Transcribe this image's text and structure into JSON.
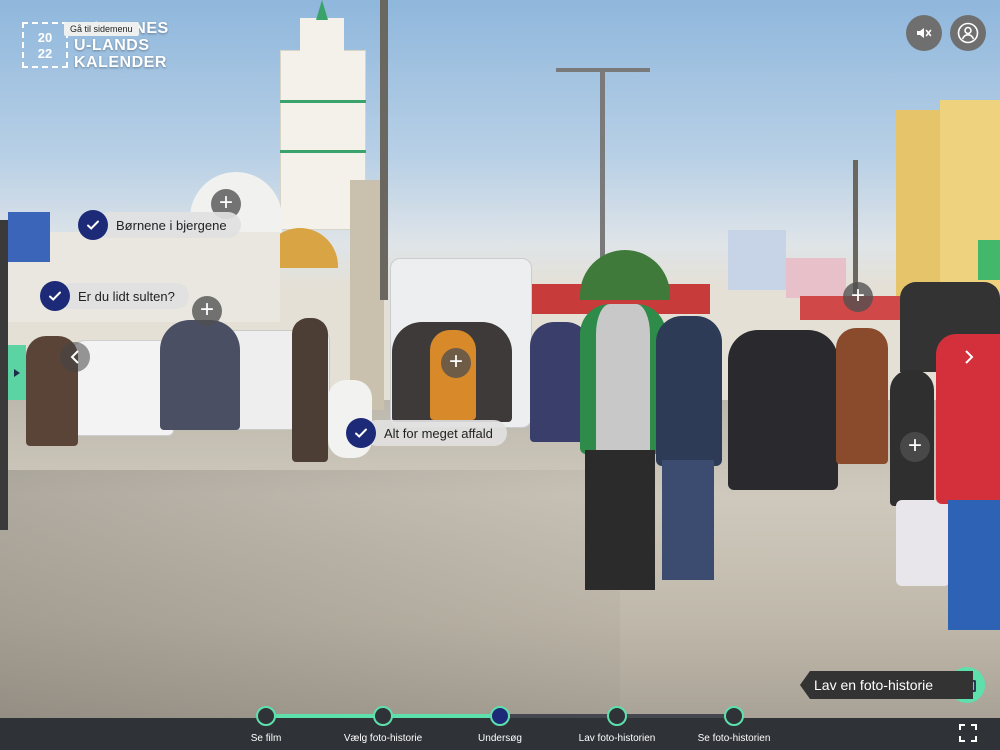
{
  "logo": {
    "year_top": "20",
    "year_bottom": "22",
    "line1": "BØRNENES",
    "line2": "U-LANDS",
    "line3": "KALENDER",
    "skip_link": "Gå til sidemenu"
  },
  "top_controls": {
    "mute_icon": "speaker-muted-icon",
    "profile_icon": "user-icon"
  },
  "hotspots": {
    "stories": [
      {
        "label": "Børnene i bjergene",
        "status": "completed"
      },
      {
        "label": "Er du lidt sulten?",
        "status": "completed"
      },
      {
        "label": "Alt for meget affald",
        "status": "completed"
      }
    ]
  },
  "cta": {
    "label": "Lav en foto-historie",
    "icon": "camera-icon"
  },
  "steps": [
    {
      "label": "Se film"
    },
    {
      "label": "Vælg foto-historie"
    },
    {
      "label": "Undersøg",
      "current": true
    },
    {
      "label": "Lav foto-historien"
    },
    {
      "label": "Se foto-historien"
    }
  ],
  "colors": {
    "accent_green": "#5ee0ad",
    "check_blue": "#1d2a78",
    "bar_dark": "#2f3236"
  }
}
